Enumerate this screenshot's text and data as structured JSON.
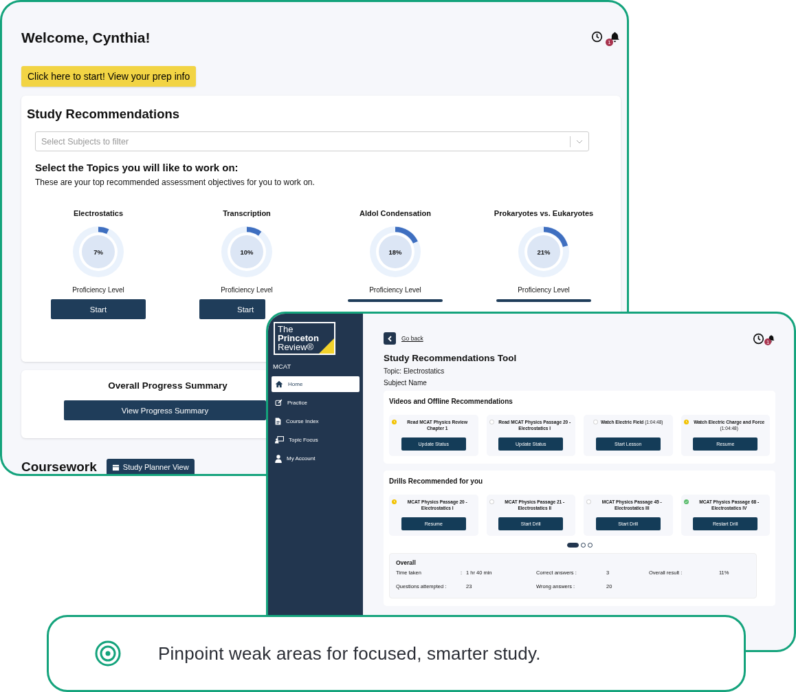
{
  "dashboard": {
    "title": "Welcome, Cynthia!",
    "notification_count": "1",
    "prep_button": "Click here to start! View your prep info",
    "recommendations": {
      "title": "Study Recommendations",
      "filter_placeholder": "Select Subjects to filter",
      "topics_heading": "Select the Topics you will like to work on:",
      "topics_description": "These are your top recommended assessment objectives for you to work on.",
      "topics": [
        {
          "name": "Electrostatics",
          "level": 0.07,
          "percent": "7%",
          "caption": "Proficiency Level",
          "button": "Start"
        },
        {
          "name": "Transcription",
          "level": 0.1,
          "percent": "10%",
          "caption": "Proficiency Level",
          "button": "Start"
        },
        {
          "name": "Aldol Condensation",
          "level": 0.18,
          "percent": "18%",
          "caption": "Proficiency Level"
        },
        {
          "name": "Prokaryotes vs. Eukaryotes",
          "level": 0.21,
          "percent": "21%",
          "caption": "Proficiency Level"
        }
      ]
    },
    "progress": {
      "title": "Overall Progress Summary",
      "button": "View Progress Summary"
    },
    "coursework": {
      "title": "Coursework",
      "button": "Study Planner View"
    }
  },
  "tool": {
    "logo": [
      "The",
      "Princeton",
      "Review®"
    ],
    "course": "MCAT",
    "nav": [
      {
        "label": "Home",
        "selected": true
      },
      {
        "label": "Practice",
        "selected": false
      },
      {
        "label": "Course Index",
        "selected": false
      },
      {
        "label": "Topic Focus",
        "selected": false
      },
      {
        "label": "My Account",
        "selected": false
      }
    ],
    "back": "Go back",
    "notification_count": "1",
    "title": "Study Recommendations Tool",
    "topic": "Topic: Electrostatics",
    "subject": "Subject Name",
    "videos": {
      "title": "Videos and Offline Recommendations",
      "items": [
        {
          "kind": "pending",
          "title": "Read MCAT Physics Review Chapter 1",
          "button": "Update Status"
        },
        {
          "kind": "new",
          "title": "Read MCAT Physics Passage 20 - Electrostatics I",
          "button": "Update Status"
        },
        {
          "kind": "new",
          "title": "Watch Electric Field",
          "duration": "(1:04:48)",
          "button": "Start Lesson"
        },
        {
          "kind": "pending",
          "title": "Watch Electric Charge and Force",
          "duration": "(1:04:48)",
          "button": "Resume"
        }
      ]
    },
    "drills": {
      "title": "Drills Recommended for you",
      "items": [
        {
          "kind": "pending",
          "title": "MCAT Physics Passage 20 - Electrostatics I",
          "button": "Resume"
        },
        {
          "kind": "new",
          "title": "MCAT Physics Passage 21 - Electrostatics II",
          "button": "Start Drill"
        },
        {
          "kind": "new",
          "title": "MCAT Physics Passage 45 - Electrostatics III",
          "button": "Start Drill"
        },
        {
          "kind": "done",
          "title": "MCAT Physics Passage 68 - Electrostatics IV",
          "button": "Restart Drill"
        }
      ],
      "pages": [
        {
          "selected": true
        },
        {
          "selected": false
        },
        {
          "selected": false
        }
      ]
    },
    "overall": {
      "title": "Overall",
      "stats": [
        {
          "label": "Time taken",
          "separator": ":",
          "value": "1 hr 40 min"
        },
        {
          "label": "Correct answers :",
          "value": "3"
        },
        {
          "label": "Overall result :",
          "value": "11%"
        },
        {
          "label": "Questions attempted :",
          "value": "23"
        },
        {
          "label": "Wrong answers :",
          "value": "20"
        }
      ]
    }
  },
  "caption": {
    "text": "Pinpoint weak areas for focused, smarter study."
  }
}
